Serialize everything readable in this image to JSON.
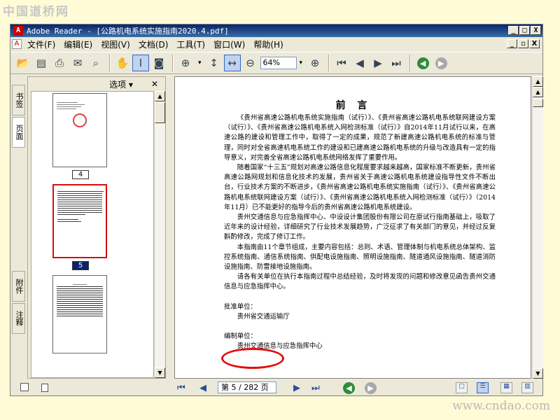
{
  "watermark_top": "中国道桥网",
  "watermark_bottom": "www.cndao.com",
  "window": {
    "title": "Adobe Reader - [公路机电系统实施指南2020.4.pdf]",
    "min": "_",
    "max": "□",
    "close": "X"
  },
  "menu": {
    "file": "文件(F)",
    "edit": "编辑(E)",
    "view": "视图(V)",
    "document": "文档(D)",
    "tools": "工具(T)",
    "window": "窗口(W)",
    "help": "帮助(H)"
  },
  "toolbar": {
    "zoom_value": "64%"
  },
  "side_tabs": {
    "bookmarks": "书签",
    "pages": "页面",
    "attachments": "附件",
    "comments": "注释"
  },
  "panel": {
    "options": "选项 ▾",
    "close": "✕",
    "pages": [
      "4",
      "5"
    ]
  },
  "document": {
    "heading": "前 言",
    "p1": "《贵州省高速公路机电系统实施指南（试行）》、《贵州省高速公路机电系统联网建设方案（试行）》、《贵州省高速公路机电系统入网检测标准（试行）》自2014年11月试行以来，在高速公路的建设和管理工作中，取得了一定的成果，规范了新建高速公路机电系统的标准与管理，同时对全省高速机电系统工作的建设和已建高速公路机电系统的升级与改造具有一定的指导意义，对完善全省高速公路机电系统网络发挥了重要作用。",
    "p2": "随着国家“十三五”规划对高速公路信息化程度要求越来越高，国家标准不断更新，贵州省高速公路网规划和信息化技术的发展，贵州省关于高速公路机电系统建设指导性文件不断出台，行业技术方案的不断进步，《贵州省高速公路机电系统实施指南（试行）》、《贵州省高速公路机电系统联网建设方案（试行）》、《贵州省高速公路机电系统入网检测标准（试行）》（2014年11月）已不能更好的指导今后的贵州省高速公路机电系统建设。",
    "p3": "贵州交通信息与应急指挥中心、中设设计集团股份有限公司在原试行指南基础上，吸取了近年来的设计经验，详细研究了行业技术发展趋势，广泛征求了有关部门的意见，并经过反复斟酌修改，完成了修订工作。",
    "p4": "本指南由11个章节组成，主要内容包括：总则、术语、管理体制与机电系统总体架构、监控系统指南、通信系统指南、供配电设施指南、照明设施指南、隧道通风设施指南、隧道消防设施指南、防雷接地设施指南。",
    "p5": "请各有关单位在执行本指南过程中总结经验，及时将发现的问题和修改意见函告贵州交通信息与应急指挥中心。",
    "approve_label": "批准单位：",
    "approve_unit": "贵州省交通运输厅",
    "compile_label": "编制单位：",
    "compile_unit": "贵州交通信息与应急指挥中心"
  },
  "status": {
    "page_indicator": "第 5 / 282 页"
  }
}
